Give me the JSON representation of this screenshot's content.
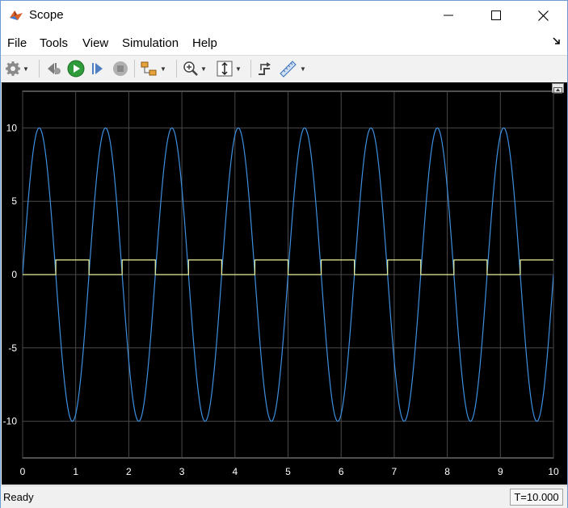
{
  "window": {
    "title": "Scope"
  },
  "menu": {
    "file": "File",
    "tools": "Tools",
    "view": "View",
    "simulation": "Simulation",
    "help": "Help"
  },
  "toolbar": {
    "buttons": [
      "configuration-properties",
      "step-back",
      "run",
      "step-forward",
      "stop",
      "highlight-simulink-block",
      "zoom-in",
      "scale-axes",
      "bring-forward",
      "cursor-measurements"
    ]
  },
  "chart_data": {
    "type": "line",
    "xlim": [
      0,
      10
    ],
    "ylim": [
      -12.5,
      12.5
    ],
    "x_ticks": [
      "0",
      "1",
      "2",
      "3",
      "4",
      "5",
      "6",
      "7",
      "8",
      "9",
      "10"
    ],
    "y_ticks": [
      "-10",
      "-5",
      "0",
      "5",
      "10"
    ],
    "grid": true,
    "background": "#000000",
    "series": [
      {
        "kind": "sine",
        "amplitude": 10,
        "period": 1.25,
        "phase": 0,
        "color": "#3d8fe0"
      },
      {
        "kind": "square",
        "low": 0,
        "high": 1,
        "period": 1.25,
        "color": "#eaf19a"
      }
    ]
  },
  "status": {
    "text": "Ready",
    "time": "T=10.000"
  }
}
